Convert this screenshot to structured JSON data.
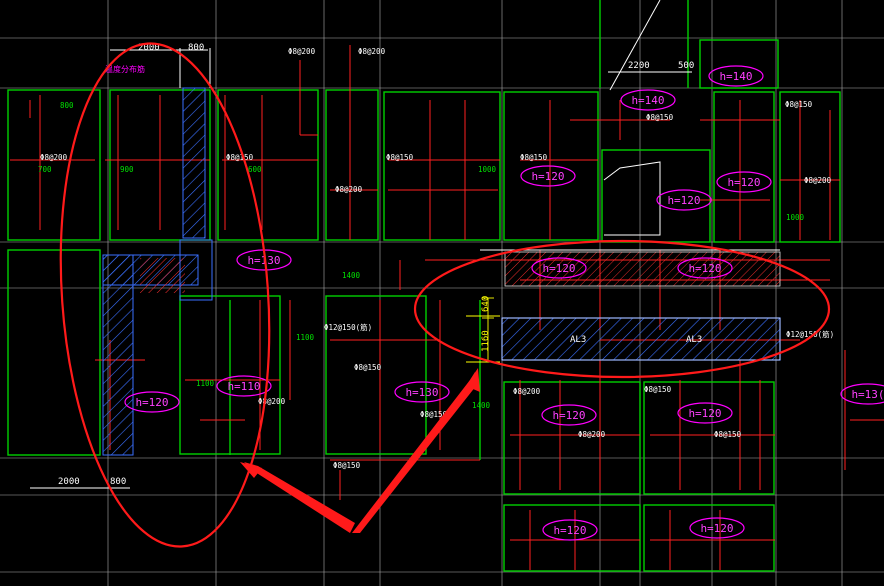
{
  "colors": {
    "background": "#000000",
    "grid": "#e8e8e8",
    "wall": "#00d000",
    "rebar": "#ff2020",
    "label": "#ffffff",
    "slab_tag": "#ff00ff",
    "dimension": "#ffff00",
    "circle": "#ff2020",
    "arrow": "#ff2020",
    "hatch": "#3a6fff"
  },
  "dimensions": {
    "top_2000": "2000",
    "top_800": "800",
    "bottom_2000": "2000",
    "bottom_800": "800",
    "mid_2200": "2200",
    "mid_500": "500",
    "beam_640": "640",
    "beam_1160": "1160"
  },
  "slab_tags": [
    {
      "id": "slab-h140-a",
      "text": "h=140"
    },
    {
      "id": "slab-h140-b",
      "text": "h=140"
    },
    {
      "id": "slab-h120-a",
      "text": "h=120"
    },
    {
      "id": "slab-h120-b",
      "text": "h=120"
    },
    {
      "id": "slab-h120-c",
      "text": "h=120"
    },
    {
      "id": "slab-h120-d",
      "text": "h=120"
    },
    {
      "id": "slab-h120-e",
      "text": "h=120"
    },
    {
      "id": "slab-h120-f",
      "text": "h=120"
    },
    {
      "id": "slab-h120-g",
      "text": "h=120"
    },
    {
      "id": "slab-h120-h",
      "text": "h=120"
    },
    {
      "id": "slab-h120-i",
      "text": "h=120"
    },
    {
      "id": "slab-h110",
      "text": "h=110"
    },
    {
      "id": "slab-h130-a",
      "text": "h=130"
    },
    {
      "id": "slab-h130-b",
      "text": "h=130"
    },
    {
      "id": "slab-h130-c",
      "text": "h=13("
    }
  ],
  "beam_labels": {
    "al3_left": "AL3",
    "al3_right": "AL3"
  },
  "rebar_labels": {
    "r1": "Φ8@200",
    "r2": "Φ8@200",
    "r3": "Φ8@150",
    "r4": "Φ8@150",
    "r5": "Φ8@200",
    "r6": "Φ8@150",
    "r7": "Φ8@150",
    "r8": "Φ8@200",
    "r9": "Φ8@150",
    "r10": "Φ8@200",
    "r11": "Φ12@150(筋)",
    "r12": "Φ8@150",
    "r13": "Φ8@200",
    "r14": "Φ8@150",
    "r15": "Φ8@200",
    "r16": "Φ12@150(筋)",
    "r17": "Φ8@150",
    "r18": "Φ8@150",
    "r19": "Φ8@200",
    "r20": "Φ8@150"
  },
  "length_labels": {
    "l1": "800",
    "l2": "700",
    "l3": "900",
    "l4": "1100",
    "l5": "1000",
    "l6": "1400",
    "l7": "1100",
    "l8": "1400",
    "l9": "600",
    "l10": "1000"
  },
  "stair_note": "温度分布筋"
}
